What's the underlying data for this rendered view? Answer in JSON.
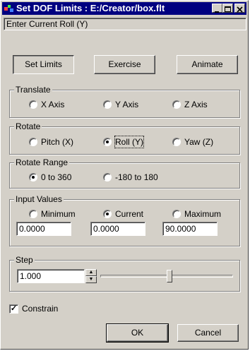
{
  "window": {
    "title": "Set DOF Limits : E:/Creator/box.flt",
    "status_text": "Enter Current Roll (Y)"
  },
  "toolbar": {
    "set_limits": "Set Limits",
    "exercise": "Exercise",
    "animate": "Animate"
  },
  "translate": {
    "legend": "Translate",
    "options": [
      "X Axis",
      "Y Axis",
      "Z Axis"
    ],
    "selected": null
  },
  "rotate": {
    "legend": "Rotate",
    "options": [
      "Pitch (X)",
      "Roll (Y)",
      "Yaw (Z)"
    ],
    "selected": "Roll (Y)"
  },
  "rotate_range": {
    "legend": "Rotate Range",
    "options": [
      "0 to 360",
      "-180 to 180"
    ],
    "selected": "0 to 360"
  },
  "input_values": {
    "legend": "Input Values",
    "options": [
      "Minimum",
      "Current",
      "Maximum"
    ],
    "selected": "Current",
    "minimum": "0.0000",
    "current": "0.0000",
    "maximum": "90.0000"
  },
  "step": {
    "legend": "Step",
    "value": "1.000",
    "slider_fraction": 0.52
  },
  "constrain": {
    "label": "Constrain",
    "checked": true,
    "mark": "✓"
  },
  "footer": {
    "ok": "OK",
    "cancel": "Cancel"
  },
  "icons": {
    "app": "app-icon",
    "minimize": "minimize-icon",
    "maximize": "maximize-icon",
    "close": "close-icon"
  },
  "colors": {
    "titlebar": "#000080",
    "face": "#d4d0c8"
  }
}
